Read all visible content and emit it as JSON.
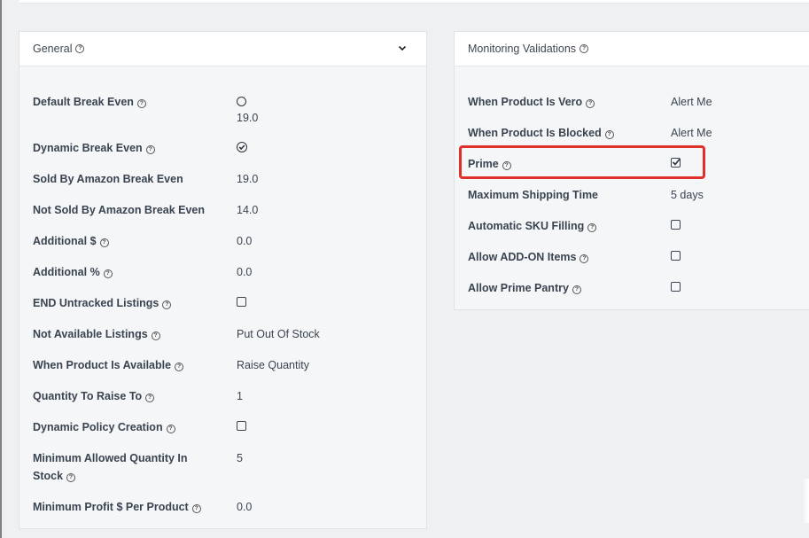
{
  "general": {
    "title": "General",
    "rows": [
      {
        "label": "Default Break Even",
        "value": "19.0"
      },
      {
        "label": "Dynamic Break Even"
      },
      {
        "label": "Sold By Amazon Break Even",
        "value": "19.0"
      },
      {
        "label": "Not Sold By Amazon Break Even",
        "value": "14.0"
      },
      {
        "label": "Additional $",
        "value": "0.0"
      },
      {
        "label": "Additional %",
        "value": "0.0"
      },
      {
        "label": "END Untracked Listings"
      },
      {
        "label": "Not Available Listings",
        "value": "Put Out Of Stock"
      },
      {
        "label": "When Product Is Available",
        "value": "Raise Quantity"
      },
      {
        "label": "Quantity To Raise To",
        "value": "1"
      },
      {
        "label": "Dynamic Policy Creation"
      },
      {
        "label_line1": "Minimum Allowed Quantity In",
        "label_line2": "Stock",
        "value": "5"
      },
      {
        "label": "Minimum Profit $ Per Product",
        "value": "0.0"
      }
    ]
  },
  "monitoring": {
    "title": "Monitoring Validations",
    "rows": [
      {
        "label": "When Product Is Vero",
        "value": "Alert Me"
      },
      {
        "label": "When Product Is Blocked",
        "value": "Alert Me"
      },
      {
        "label": "Prime",
        "checked": true
      },
      {
        "label": "Maximum Shipping Time",
        "value": "5 days"
      },
      {
        "label": "Automatic SKU Filling",
        "checked": false
      },
      {
        "label": "Allow ADD-ON Items",
        "checked": false
      },
      {
        "label": "Allow Prime Pantry",
        "checked": false
      }
    ]
  },
  "help_glyph": "?",
  "colors": {
    "highlight": "#e0302a"
  }
}
